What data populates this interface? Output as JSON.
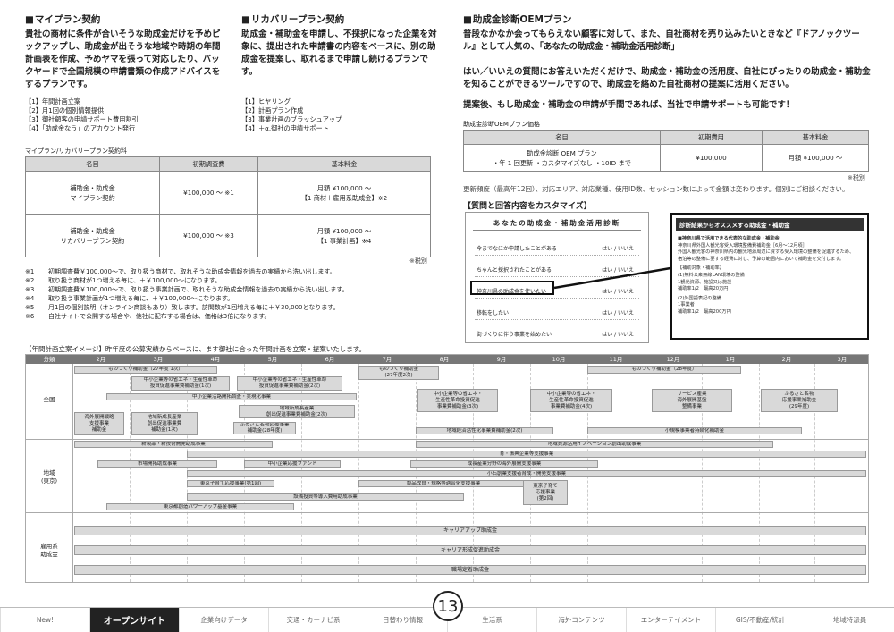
{
  "my_plan": {
    "heading": "マイプラン契約",
    "body": "貴社の商材に条件が合いそうな助成金だけを予めピックアップし、助成金が出そうな地域や時期の年間計画表を作成、予めヤマを張って対応したり、バックヤードで全国規模の申請書類の作成アドバイスをするプランです。",
    "items": [
      "【1】年間計画立案",
      "【2】月1回の個別情報提供",
      "【3】御社顧客の申請サポート費用割引",
      "【4】「助成金なう」のアカウント発行"
    ]
  },
  "recovery_plan": {
    "heading": "リカバリープラン契約",
    "body": "助成金・補助金を申請し、不採択になった企業を対象に、提出された申請書の内容をベースに、別の助成金を提案し、取れるまで申請し続けるプランです。",
    "items": [
      "【1】ヒヤリング",
      "【2】計画プラン作成",
      "【3】事業計画のブラッシュアップ",
      "【4】＋α.御社の申請サポート"
    ]
  },
  "plan_fees": {
    "caption": "マイプラン/リカバリープラン契約料",
    "headers": [
      "名目",
      "初期調査費",
      "基本料金"
    ],
    "rows": [
      {
        "name": [
          "補助金・助成金",
          "マイプラン契約"
        ],
        "initial": "¥100,000 〜 ※1",
        "basic": [
          "月額 ¥100,000 〜",
          "【1 商材＋雇用系助成金】※2"
        ]
      },
      {
        "name": [
          "補助金・助成金",
          "リカバリープラン契約"
        ],
        "initial": "¥100,000 〜 ※3",
        "basic": [
          "月額 ¥100,000 〜",
          "【1 事業計画】※4"
        ]
      }
    ],
    "tax_note": "※税別"
  },
  "notes": [
    {
      "mark": "※1",
      "text": "初期調査費￥100,000〜で、取り扱う商材で、取れそうな助成金情報を過去の実績から洗い出します。"
    },
    {
      "mark": "※2",
      "text": "取り扱う商材が1つ増える毎に、＋￥100,000〜になります。"
    },
    {
      "mark": "※3",
      "text": "初期調査費￥100,000〜で、取り扱う事業計画で、取れそうな助成金情報を過去の実績から洗い出します。"
    },
    {
      "mark": "※4",
      "text": "取り扱う事業計画が1つ増える毎に、＋￥100,000〜になります。"
    },
    {
      "mark": "※5",
      "text": "月1回の個別説明（オンライン商談もあり）致します。訪問数が1回増える毎に＋￥30,000となります。"
    },
    {
      "mark": "※6",
      "text": "自社サイトで公開する場合や、他社に配布する場合は、価格は3倍になります。"
    }
  ],
  "oem": {
    "heading": "助成金診断OEMプラン",
    "body1": "普段なかなか会ってもらえない顧客に対して、また、自社商材を売り込みたいときなど『ドアノックツール』として人気の、「あなたの助成金・補助金活用診断」",
    "body2": "はい／いいえの質問にお答えいただくだけで、助成金・補助金の活用度、自社にぴったりの助成金・補助金を知ることができるツールですので、助成金を絡めた自社商材の提案に活用ください。",
    "body3": "提案後、もし助成金・補助金の申請が手間であれば、当社で申請サポートも可能です！",
    "price_caption": "助成金診断OEMプラン価格",
    "headers": [
      "名目",
      "初期費用",
      "基本料金"
    ],
    "row": {
      "name": [
        "助成金診断 OEM プラン",
        "・年 1 回更新 ・カスタマイズなし ・10ID まで"
      ],
      "initial": "¥100,000",
      "basic": "月額 ¥100,000 〜"
    },
    "tax_note": "※税別",
    "fee_note": "更新頻度（最高年12回）、対応エリア、対応業種、使用ID数、セッション数によって金額は変わります。個別にご相談ください。",
    "customize_heading": "【質問と回答内容をカスタマイズ】"
  },
  "mock_quiz": {
    "title": "あなたの助成金・補助金活用診断",
    "questions": [
      "今までなにか申請したことがある",
      "ちゃんと採択されたことがある",
      "神奈川県の助成金を使いたい",
      "移転をしたい",
      "街づくりに伴う事業を始めたい"
    ],
    "answer": "はい / いいえ"
  },
  "mock_result": {
    "title": "診断結果からオススメする助成金・補助金",
    "l1": "■神奈川県で活用できる代表的な助成金・補助金",
    "l2": "神奈川県外国人観光客受入環境整備費補助金［6月〜12月頃］",
    "l3": "外国人観光客の神奈川県内の観光地源周辺に資する受入環境の整備を促進するため、",
    "l4": "宿泊等の整備に要する経費に対し、予算の範囲内において補助金を交付します。",
    "l5": "【補助対象・補助率】",
    "l6": "(1)無料公衆無線LAN環境の整備",
    "l7": "1観光資源、施設又は施設",
    "l8": "補助率1/2　最高20万円",
    "l9": "(2)外国語表記の整備",
    "l10": "1事業者",
    "l11": "補助率1/2　最高200万円"
  },
  "calendar": {
    "caption": "【年間計画立案イメージ】昨年度の公募実績からベースに、ます御社に合った年間計画を立案・提案いたします。",
    "months": [
      "分類",
      "2月",
      "3月",
      "4月",
      "5月",
      "6月",
      "7月",
      "8月",
      "9月",
      "10月",
      "11月",
      "12月",
      "1月",
      "2月",
      "3月"
    ],
    "categories": {
      "national": "全国",
      "regional": "地域\n(東京)",
      "employment": "雇用系\n助成金"
    },
    "bars": [
      "ものづくり補助金（27年度 1次）",
      "ものづくり補助金\n(27年度2次)",
      "ものづくり補助金（28年度）",
      "中小企業等の省エネ・生産性革命\n投資促進事業費補助金(1次)",
      "中小企業等の省エネ・生産性革命\n投資促進事業費補助金(2次)",
      "中小企業活路開拓調査・実現化事業",
      "中小企業等の省エネ・\n生産性革命投資促進\n事業費補助金(3次)",
      "中小企業等の省エネ・\n生産性革命投資促進\n事業費補助金(4次)",
      "サービス産業\n海外展開基盤\n整備事業",
      "ふるさと名物\n応援事業補助金\n(29年度)",
      "地域新成長産業\n創出促進事業費補助金(2次)",
      "海外展開戦略\n支援事業\n補助金",
      "地域新成長産業\n創出促進事業費\n補助金(1次)",
      "ふるさと名物応援事業\n補助金(28年度)",
      "地域経済活性化事業費補助金(2次)",
      "小規模事業者持続化補助金",
      "新製品・新技術開発助成事業",
      "地域資源活用イノベーション創出助成事業",
      "育・振興企業等支援事業",
      "市場開拓助成事業",
      "中小企業応援ファンド",
      "成長産業分野の海外展開支援事業",
      "小石創業支援者育成・開発支援事業",
      "東京子育て応援事業(第1回)",
      "製品改良・規格等適合化支援事業",
      "東京子育て\n応援事業\n(第2回)",
      "設備投資等導入費用助成事業",
      "東京都創造パワーアップ基金事業",
      "キャリアアップ助成金",
      "キャリア形成促進助成金",
      "職場定着助成金"
    ]
  },
  "page_number": "13",
  "footer_tabs": [
    "New!",
    "オープンサイト",
    "企業向けデータ",
    "交通・カーナビ系",
    "日替わり情報",
    "生活系",
    "海外コンテンツ",
    "エンターテイメント",
    "GIS/不動産/統計",
    "地域特派員"
  ]
}
